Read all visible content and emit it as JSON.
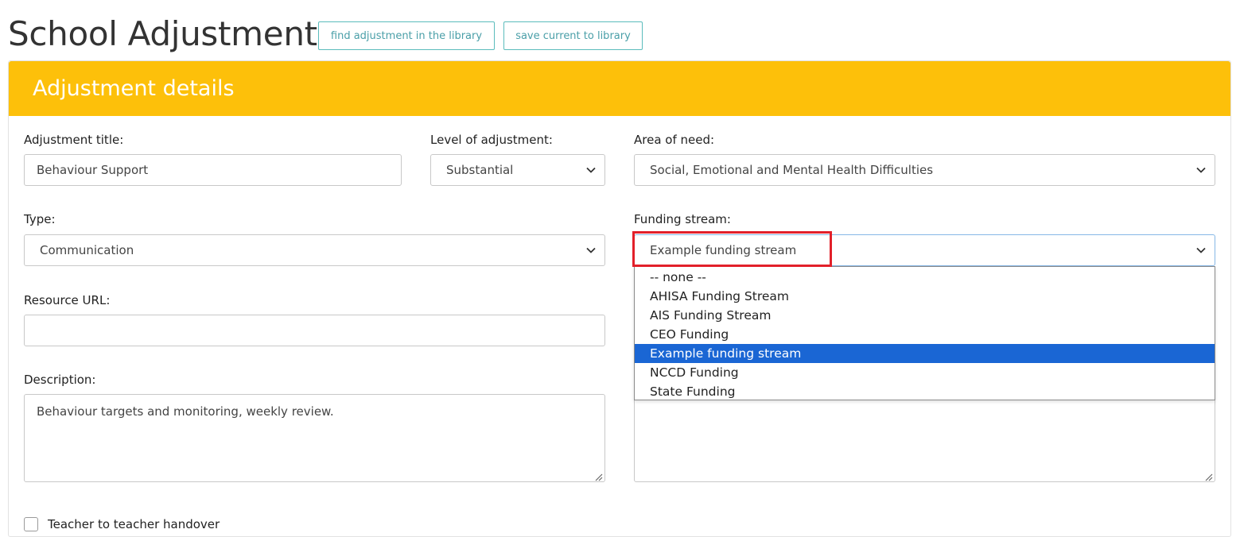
{
  "page": {
    "title": "School Adjustment",
    "buttons": {
      "find_library": "find adjustment in the library",
      "save_library": "save current to library"
    }
  },
  "panel": {
    "heading": "Adjustment details",
    "color_heading_bg": "#fdc00a"
  },
  "form": {
    "title": {
      "label": "Adjustment title:",
      "value": "Behaviour Support"
    },
    "level": {
      "label": "Level of adjustment:",
      "value": "Substantial"
    },
    "area": {
      "label": "Area of need:",
      "value": "Social, Emotional and Mental Health Difficulties"
    },
    "type": {
      "label": "Type:",
      "value": "Communication"
    },
    "funding": {
      "label": "Funding stream:",
      "value": "Example funding stream",
      "options": [
        "-- none --",
        "AHISA Funding Stream",
        "AIS Funding Stream",
        "CEO Funding",
        "Example funding stream",
        "NCCD Funding",
        "State Funding"
      ],
      "selected_index": 4
    },
    "resource": {
      "label": "Resource URL:",
      "value": ""
    },
    "description": {
      "label": "Description:",
      "value": "Behaviour targets and monitoring, weekly review."
    },
    "checkbox": {
      "label": "Teacher to teacher handover",
      "checked": false
    }
  },
  "icons": {
    "chevron": "chevron-down-icon",
    "resize": "resize-grip-icon"
  },
  "annotation": {
    "color": "#e2202a"
  }
}
